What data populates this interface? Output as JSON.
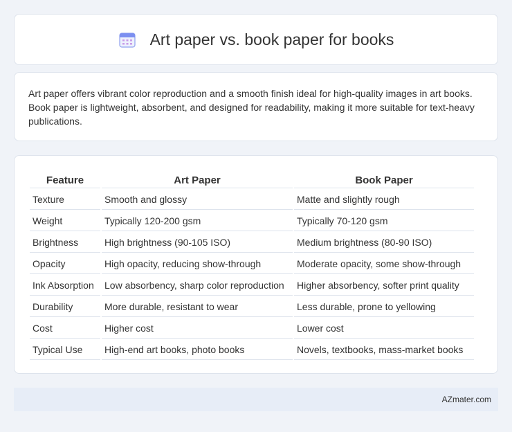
{
  "header": {
    "title": "Art paper vs. book paper for books",
    "icon": "calendar-icon"
  },
  "intro": {
    "text": "Art paper offers vibrant color reproduction and a smooth finish ideal for high-quality images in art books. Book paper is lightweight, absorbent, and designed for readability, making it more suitable for text-heavy publications."
  },
  "table": {
    "headers": [
      "Feature",
      "Art Paper",
      "Book Paper"
    ],
    "rows": [
      [
        "Texture",
        "Smooth and glossy",
        "Matte and slightly rough"
      ],
      [
        "Weight",
        "Typically 120-200 gsm",
        "Typically 70-120 gsm"
      ],
      [
        "Brightness",
        "High brightness (90-105 ISO)",
        "Medium brightness (80-90 ISO)"
      ],
      [
        "Opacity",
        "High opacity, reducing show-through",
        "Moderate opacity, some show-through"
      ],
      [
        "Ink Absorption",
        "Low absorbency, sharp color reproduction",
        "Higher absorbency, softer print quality"
      ],
      [
        "Durability",
        "More durable, resistant to wear",
        "Less durable, prone to yellowing"
      ],
      [
        "Cost",
        "Higher cost",
        "Lower cost"
      ],
      [
        "Typical Use",
        "High-end art books, photo books",
        "Novels, textbooks, mass-market books"
      ]
    ]
  },
  "footer": {
    "text": "AZmater.com"
  },
  "colors": {
    "background": "#f0f3f8",
    "footer_bg": "#e7edf7",
    "icon_accent": "#7c8ff0"
  }
}
